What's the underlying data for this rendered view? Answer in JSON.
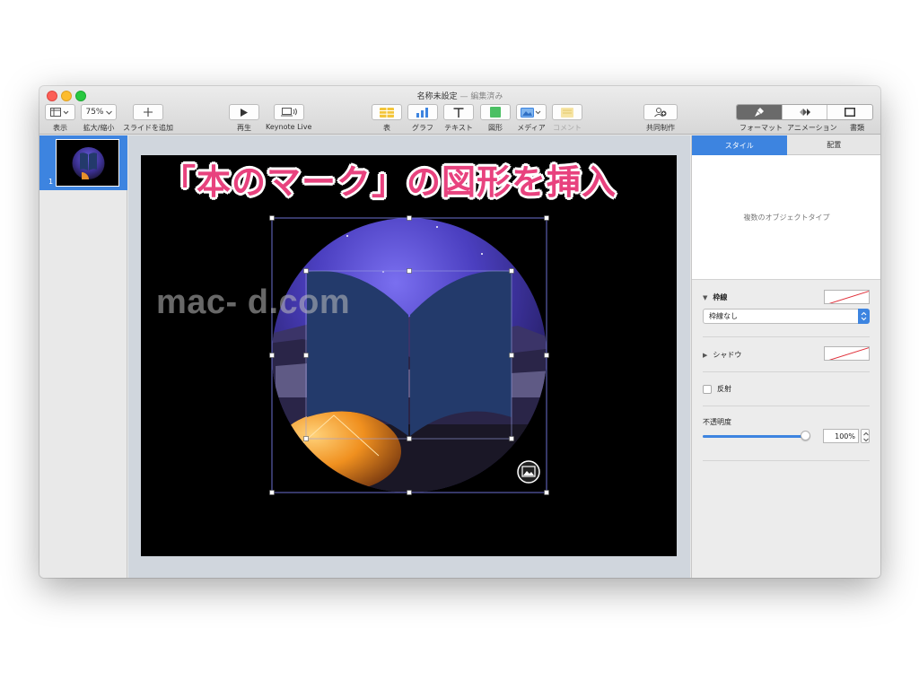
{
  "window": {
    "title": "名称未設定",
    "title_sep": "—",
    "title_status": "編集済み"
  },
  "toolbar": {
    "view_label": "表示",
    "zoom_value": "75%",
    "zoom_label": "拡大/縮小",
    "add_slide_label": "スライドを追加",
    "play_label": "再生",
    "keynote_live_label": "Keynote Live",
    "table_label": "表",
    "chart_label": "グラフ",
    "text_label": "テキスト",
    "shape_label": "図形",
    "media_label": "メディア",
    "comment_label": "コメント",
    "collaborate_label": "共同制作",
    "format_label": "フォーマット",
    "animate_label": "アニメーション",
    "document_label": "書類"
  },
  "navigator": {
    "slide_number": "1"
  },
  "slide": {
    "watermark": "mac-        d.com",
    "annotation": "「本のマーク」の図形を挿入"
  },
  "inspector": {
    "tab_style": "スタイル",
    "tab_arrange": "配置",
    "object_type": "複数のオブジェクトタイプ",
    "border_label": "枠線",
    "border_value": "枠線なし",
    "shadow_label": "シャドウ",
    "reflection_label": "反射",
    "opacity_label": "不透明度",
    "opacity_value": "100%",
    "opacity_fraction": 1.0
  },
  "colors": {
    "accent": "#3d84e0",
    "annotation": "#e8427e",
    "book_shape": "#233a6b"
  },
  "icons": [
    "view-icon",
    "zoom-chevron-icon",
    "plus-icon",
    "play-icon",
    "keynote-live-icon",
    "table-icon",
    "chart-icon",
    "text-icon",
    "shape-icon",
    "media-icon",
    "comment-icon",
    "collaborate-icon",
    "format-brush-icon",
    "animate-icon",
    "document-icon",
    "image-placeholder-icon"
  ]
}
